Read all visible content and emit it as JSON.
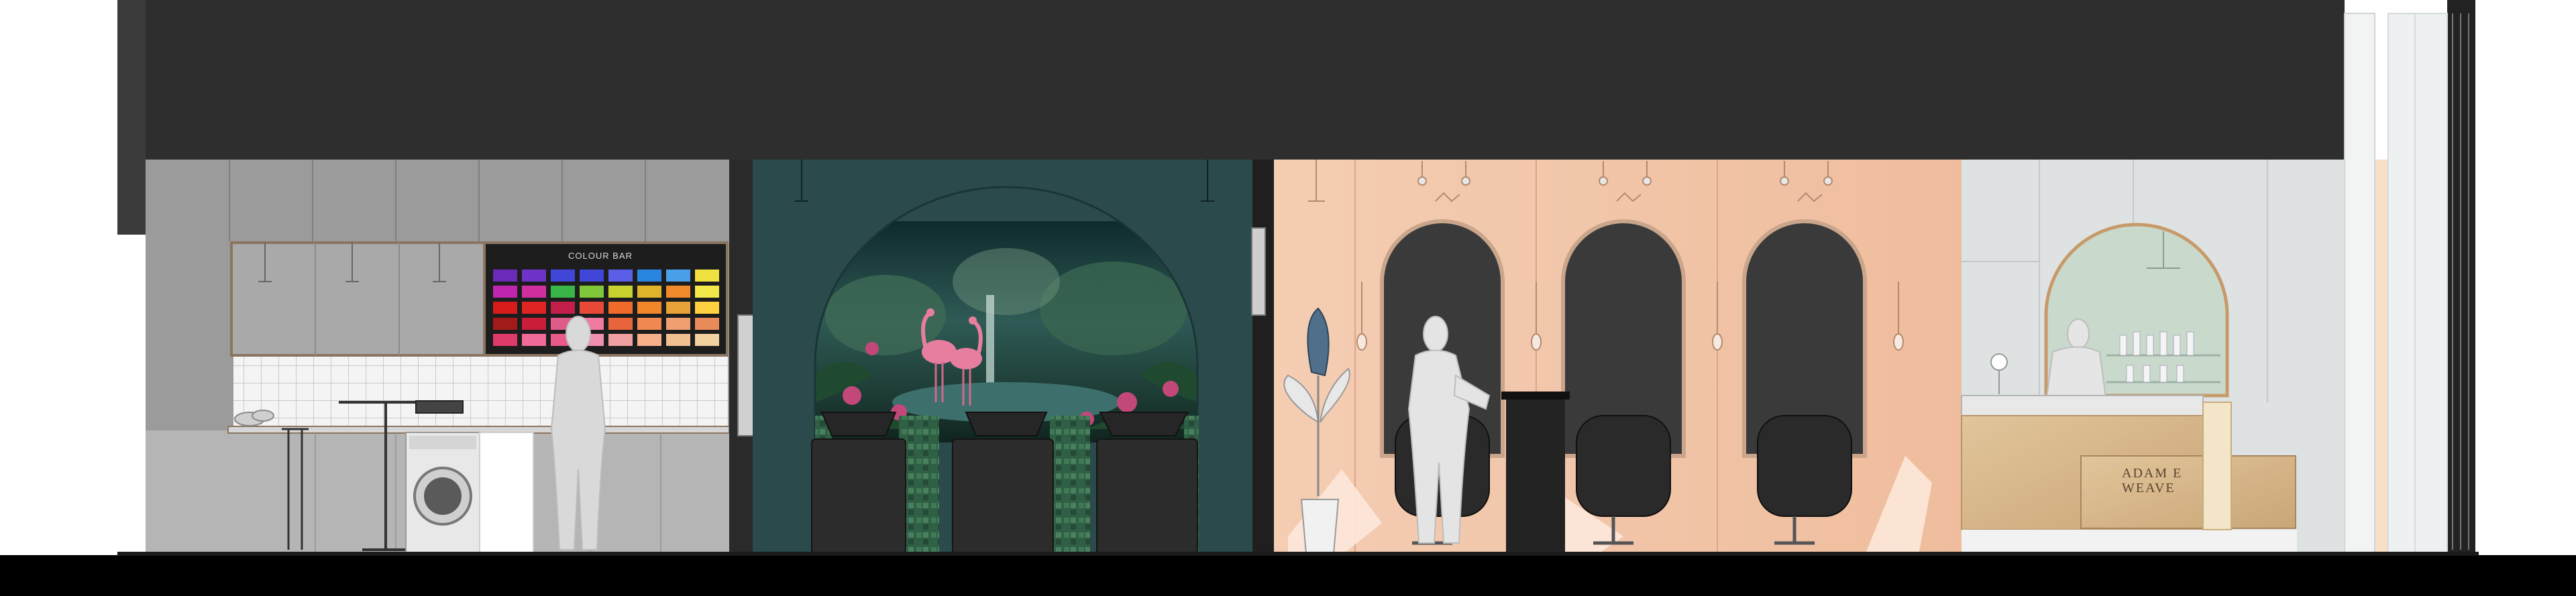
{
  "elevation": {
    "colour_bar_sign": "COLOUR BAR",
    "reception_logo_line1": "ADAM E",
    "reception_logo_line2": "WEAVE"
  },
  "colors": {
    "ceiling": "#2e2e2e",
    "floor": "#000000",
    "kitchen_wall": "#9b9b9b",
    "cabinet": "#a9a9a9",
    "teal_wall": "#2a4a4b",
    "peach_wall": "#f2c4a6",
    "reception_wall": "#dfe2e2",
    "mirror_dark": "#3a3a3a",
    "wood": "#d8b98e",
    "arch_mint": "#c9dacd"
  },
  "icons": {
    "pendant_light": "pendant-light-icon",
    "track_spot": "track-spot-icon",
    "figure": "person-figure-icon",
    "washing_machine": "washing-machine-icon",
    "plant": "potted-plant-icon",
    "salon_chair": "salon-chair-icon",
    "wash_basin": "wash-basin-icon"
  }
}
